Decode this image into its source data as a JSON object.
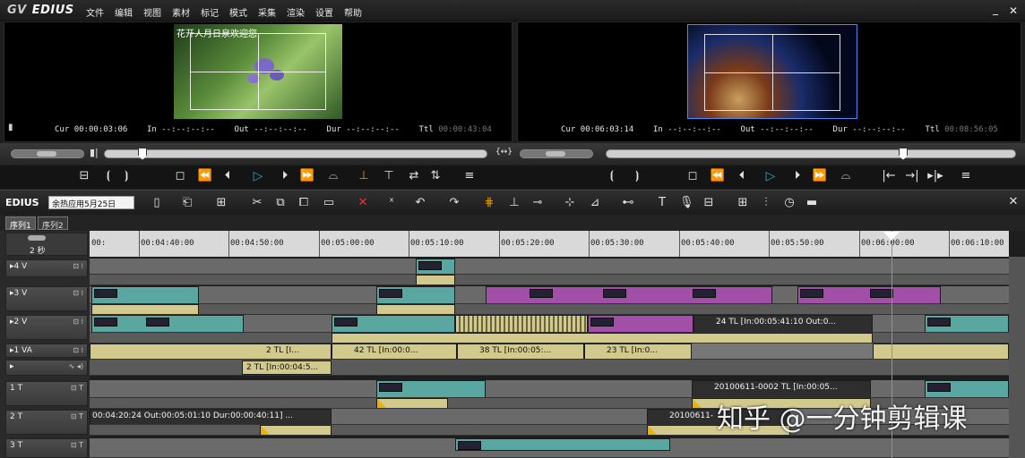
{
  "app": {
    "logo": "EDIUS",
    "logo_icon": "grass-valley-icon"
  },
  "menu": [
    "文件",
    "编辑",
    "视图",
    "素材",
    "标记",
    "模式",
    "采集",
    "渲染",
    "设置",
    "帮助"
  ],
  "window": {
    "minimize": "_",
    "close": "✕"
  },
  "player": {
    "overlay_text": "花开人月日泉欢迎您",
    "cur_label": "Cur",
    "cur": "00:00:03:06",
    "in_label": "In",
    "in": "--:--:--:--",
    "out_label": "Out",
    "out": "--:--:--:--",
    "dur_label": "Dur",
    "dur": "--:--:--:--",
    "ttl_label": "Ttl",
    "ttl": "00:00:43:04",
    "position": 0.09
  },
  "recorder": {
    "cur_label": "Cur",
    "cur": "00:06:03:14",
    "in_label": "In",
    "in": "--:--:--:--",
    "out_label": "Out",
    "out": "--:--:--:--",
    "dur_label": "Dur",
    "dur": "--:--:--:--",
    "ttl_label": "Ttl",
    "ttl": "00:08:56:05",
    "position": 0.73
  },
  "sync_icon": "link-sync-icon",
  "timeline": {
    "app_label": "EDIUS",
    "sequence": "余热应用5月25日",
    "tabs": [
      "序列1",
      "序列2"
    ],
    "scale": "2 秒",
    "ruler": [
      "00:",
      "00:04:40:00",
      "00:04:50:00",
      "00:05:00:00",
      "00:05:10:00",
      "00:05:20:00",
      "00:05:30:00",
      "00:05:40:00",
      "00:05:50:00",
      "00:06:00:00",
      "00:06:10:00"
    ],
    "tracks": [
      {
        "name": "4 V"
      },
      {
        "name": "3 V"
      },
      {
        "name": "2 V"
      },
      {
        "name": "1 VA"
      },
      {
        "name": ""
      },
      {
        "name": "1 T"
      },
      {
        "name": "2 T"
      },
      {
        "name": "3 T"
      }
    ],
    "clip_labels": {
      "v2_tl": "24  TL [In:00:05:41:10 Out:0...",
      "va_a": "2  TL [I...",
      "va_b": "42  TL [In:00:0...",
      "va_c": "38  TL [In:00:05:...",
      "va_d": "23  TL [In:0...",
      "va_sub": "2  TL [In:00:04:5...",
      "t1_a": "20100611-0002  TL [In:00:05...",
      "t2_a": "00:04:20:24 Out:00:05:01:10 Dur:00:00:40:11]  ...",
      "t2_b": "20100611-"
    }
  },
  "watermark": "知乎 @一分钟剪辑课"
}
